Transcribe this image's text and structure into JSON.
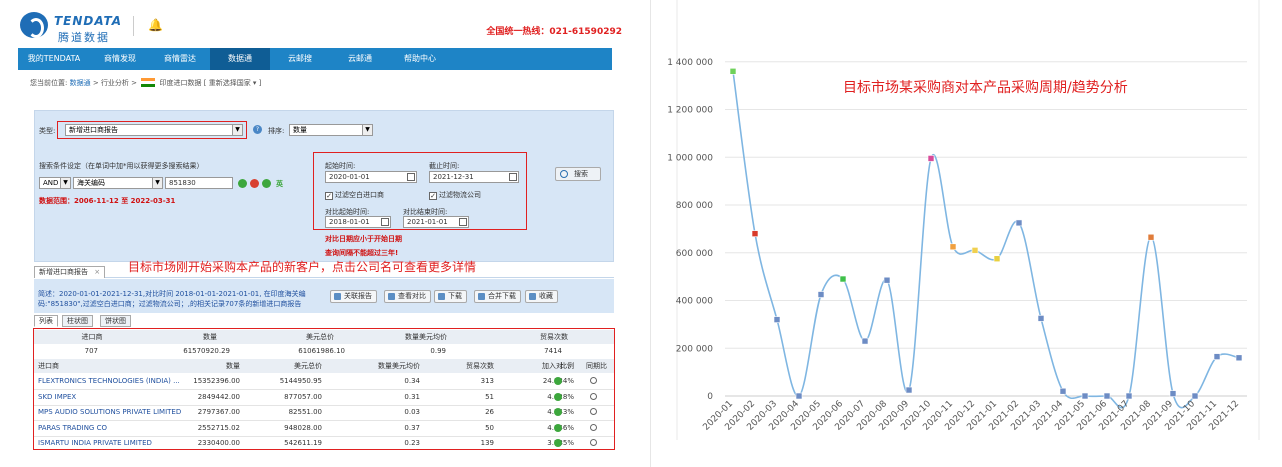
{
  "app": {
    "logo_en": "TENDATA",
    "logo_cn": "腾道数据",
    "hotline": "全国统一热线：021-61590292"
  },
  "nav": {
    "items": [
      "我的TENDATA",
      "商情发现",
      "商情雷达",
      "数据通",
      "云邮搜",
      "云邮通",
      "帮助中心"
    ],
    "active_index": 3
  },
  "breadcrumb": {
    "prefix": "您当前位置:",
    "link1": "数据通",
    "sep": ">",
    "item2": "行业分析",
    "item3": "印度进口数据 [ 重新选择国家 ▾ ]"
  },
  "search_panel": {
    "type_label": "类型:",
    "type_value": "新增进口商报告",
    "sort_label": "排序:",
    "sort_value": "数量",
    "cond_label": "搜索条件设定（在单词中加*用以获得更多搜索结果）",
    "logic_value": "AND",
    "field_value": "海关编码",
    "code_value": "851830",
    "range_text": "数据范围：2006-11-12 至 2022-03-31",
    "start_label": "起始时间:",
    "start_value": "2020-01-01",
    "end_label": "截止时间:",
    "end_value": "2021-12-31",
    "filter_empty": "过滤空白进口商",
    "filter_logistics": "过滤物流公司",
    "cmp_start_label": "对比起始时间:",
    "cmp_start_value": "2018-01-01",
    "cmp_end_label": "对比结束时间:",
    "cmp_end_value": "2021-01-01",
    "search_button": "搜索",
    "ying": "英",
    "warn1": "对比日期应小于开始日期",
    "warn2": "查询间隔不能超过三年!"
  },
  "annotation_left": "目标市场刚开始采购本产品的新客户，点击公司名可查看更多详情",
  "report": {
    "tab_label": "新增进口商报告",
    "tab_close": "×",
    "summary": "简述：2020-01-01-2021-12-31,对比时间 2018-01-01-2021-01-01,   在印度海关编码:\"851830\",过滤空白进口商；过滤物流公司；,的相关记录707条的新增进口商报告",
    "buttons": [
      "关联报告",
      "查看对比",
      "下载",
      "合并下载",
      "收藏"
    ],
    "subtabs": [
      "列表",
      "柱状图",
      "饼状图"
    ]
  },
  "totals": {
    "headers": [
      "进口商",
      "数量",
      "美元总价",
      "数量美元均价",
      "贸易次数"
    ],
    "values": [
      "707",
      "61570920.29",
      "61061986.10",
      "0.99",
      "7414"
    ]
  },
  "table": {
    "headers": [
      "进口商",
      "数量",
      "美元总价",
      "数量美元均价",
      "贸易次数",
      "比例",
      "加入对...",
      "同期比"
    ],
    "rows": [
      [
        "FLEXTRONICS TECHNOLOGIES (INDIA) ...",
        "15352396.00",
        "5144950.95",
        "0.34",
        "313",
        "24.934%"
      ],
      [
        "SKD IMPEX",
        "2849442.00",
        "877057.00",
        "0.31",
        "51",
        "4.628%"
      ],
      [
        "MPS AUDIO SOLUTIONS PRIVATE LIMITED",
        "2797367.00",
        "82551.00",
        "0.03",
        "26",
        "4.543%"
      ],
      [
        "PARAS TRADING CO",
        "2552715.02",
        "948028.00",
        "0.37",
        "50",
        "4.146%"
      ],
      [
        "ISMARTU INDIA PRIVATE LIMITED",
        "2330400.00",
        "542611.19",
        "0.23",
        "139",
        "3.785%"
      ]
    ]
  },
  "chart_data": {
    "type": "line",
    "title": "目标市场某采购商对本产品采购周期/趋势分析",
    "categories": [
      "2020-01",
      "2020-02",
      "2020-03",
      "2020-04",
      "2020-05",
      "2020-06",
      "2020-07",
      "2020-08",
      "2020-09",
      "2020-10",
      "2020-11",
      "2020-12",
      "2021-01",
      "2021-02",
      "2021-03",
      "2021-04",
      "2021-05",
      "2021-06",
      "2021-07",
      "2021-08",
      "2021-09",
      "2021-10",
      "2021-11",
      "2021-12"
    ],
    "values": [
      1360000,
      680000,
      320000,
      0,
      425000,
      490000,
      230000,
      485000,
      25000,
      995000,
      625000,
      610000,
      575000,
      725000,
      325000,
      20000,
      0,
      0,
      0,
      665000,
      10000,
      0,
      165000,
      160000
    ],
    "point_colors": [
      "#6fd15a",
      "#d83a2a",
      "#6d8cc4",
      "#6d8cc4",
      "#6d8cc4",
      "#3fc04a",
      "#6d8cc4",
      "#6d8cc4",
      "#6d8cc4",
      "#d84b9a",
      "#f0a040",
      "#f0d050",
      "#e8d040",
      "#6d8cc4",
      "#6d8cc4",
      "#6d8cc4",
      "#6d8cc4",
      "#6d8cc4",
      "#6d8cc4",
      "#e07c3a",
      "#6d8cc4",
      "#6d8cc4",
      "#6d8cc4",
      "#6d8cc4"
    ],
    "ylim": [
      0,
      1600000
    ],
    "yticks": [
      0,
      200000,
      400000,
      600000,
      800000,
      1000000,
      1200000,
      1400000
    ],
    "ytick_labels": [
      "0",
      "200 000",
      "400 000",
      "600 000",
      "800 000",
      "1 000 000",
      "1 200 000",
      "1 400 000"
    ],
    "line_color": "#7fb6e2",
    "grid": true
  }
}
